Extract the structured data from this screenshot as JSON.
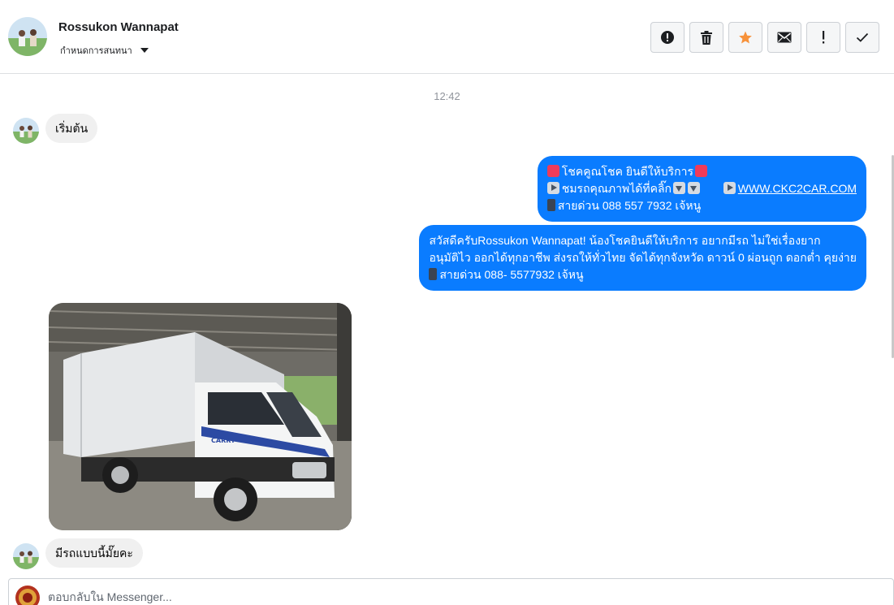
{
  "header": {
    "contact_name": "Rossukon Wannapat",
    "conversation_settings_label": "กำหนดการสนทนา",
    "actions": [
      {
        "name": "report-spam-button",
        "icon": "exclamation-circle-icon"
      },
      {
        "name": "delete-button",
        "icon": "trash-icon"
      },
      {
        "name": "star-button",
        "icon": "star-icon",
        "color": "#f7923b"
      },
      {
        "name": "email-button",
        "icon": "envelope-icon"
      },
      {
        "name": "mark-important-button",
        "icon": "exclamation-icon"
      },
      {
        "name": "mark-done-button",
        "icon": "check-icon"
      }
    ]
  },
  "thread": {
    "timestamp": "12:42",
    "messages": [
      {
        "direction": "incoming",
        "text": "เริ่มต้น"
      },
      {
        "direction": "outgoing",
        "lines": [
          {
            "icon": "mail-emoji",
            "text": "โชคคูณโชค ยินดีให้บริการ",
            "trail_icon": "mail-emoji"
          },
          {
            "icon": "play-emoji",
            "text": "ชมรถคุณภาพได้ที่คลิ๊ก",
            "link_prefix_icon": "play-emoji",
            "link": "WWW.CKC2CAR.COM"
          },
          {
            "icon": "phone-emoji",
            "text": "สายด่วน 088 557 7932 เจ้หนู"
          }
        ]
      },
      {
        "direction": "outgoing",
        "lines": [
          {
            "text": "สวัสดีครับRossukon Wannapat! น้องโชคยินดีให้บริการ อยากมีรถ ไม่ใช่เรื่องยาก"
          },
          {
            "text": "อนุมัติไว ออกได้ทุกอาชีพ ส่งรถให้ทั่วไทย จัดได้ทุกจังหวัด ดาวน์ 0  ผ่อนถูก ดอกต่ำ คุยง่าย"
          },
          {
            "icon": "phone-emoji",
            "text": "สายด่วน 088- 5577932 เจ้หนู"
          }
        ]
      },
      {
        "direction": "incoming",
        "type": "photo",
        "alt": "CARRY"
      },
      {
        "direction": "incoming",
        "text": "มีรถแบบนี้มั๊ยคะ"
      }
    ]
  },
  "composer": {
    "placeholder": "ตอบกลับใน Messenger..."
  },
  "colors": {
    "outgoing_bubble": "#0a7cff",
    "incoming_bubble": "#f0f0f0",
    "star": "#f7923b"
  }
}
